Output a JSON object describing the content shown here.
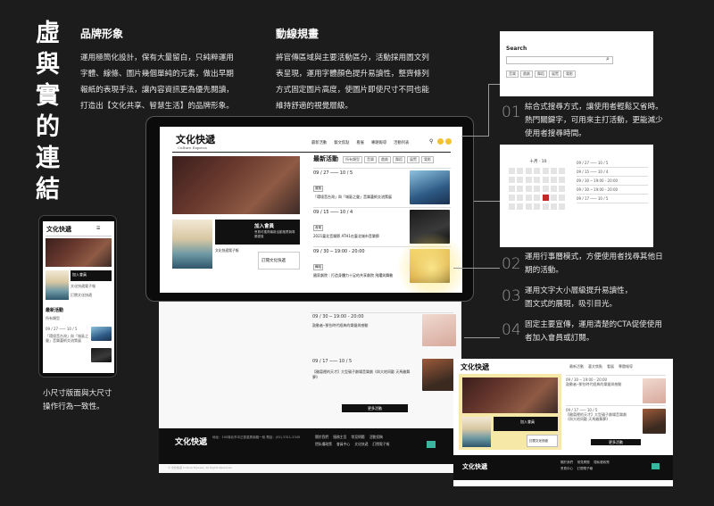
{
  "title_vertical": [
    "虛",
    "與",
    "實",
    "的",
    "連",
    "結"
  ],
  "brand": {
    "heading": "品牌形象",
    "lines": [
      "運用極簡化設計，保有大量留白，只純粹運用",
      "字體、線條、圖片幾個單純的元素，做出早期",
      "報紙的表現手法，讓內容資訊更為優先閱讀，",
      "打造出【文化共享、智慧生活】的品牌形象。"
    ]
  },
  "flow": {
    "heading": "動線規畫",
    "lines": [
      "將官傳區域與主要活動區分，活動採用圖文列",
      "表呈現，運用字體顏色提升易讀性，整齊條列",
      "方式固定圖片高度，使圖片即使尺寸不同也能",
      "維持舒適的視覺層級。"
    ]
  },
  "mobile_caption": [
    "小尺寸版面與大尺寸",
    "操作行為一致性。"
  ],
  "notes": [
    {
      "num": "01",
      "lines": [
        "綜合式搜尋方式，讓使用者輕鬆又省時。",
        "熱門關鍵字，可用來主打活動，更能減少",
        "使用者搜尋時間。"
      ]
    },
    {
      "num": "02",
      "lines": [
        "運用行事曆模式，方便使用者找尋其他日",
        "期的活動。"
      ]
    },
    {
      "num": "03",
      "lines": [
        "運用文字大小層級提升易讀性，",
        "圖文式的展現，吸引目光。"
      ]
    },
    {
      "num": "04",
      "lines": [
        "固定主要宣傳，運用清楚的CTA促使使用",
        "者加入會員或訂閱。"
      ]
    }
  ],
  "site": {
    "logo": "文化快遞",
    "logo_sub": "Culture Express",
    "nav": [
      "最新活動",
      "藝文焦點",
      "看展",
      "專題報導",
      "活動列表"
    ],
    "latest_heading": "最新活動",
    "filters": [
      "所有類型",
      "音樂",
      "戲劇",
      "舞蹈",
      "展覽",
      "電影",
      "其他"
    ],
    "join_title": "加入會員",
    "join_text": "會員可獲得最新活動推薦與專屬優惠",
    "subscribe": "訂閱文化快遞",
    "app_label": "文化快遞電子報",
    "more_button": "更多活動",
    "search_title": "Search",
    "calendar_month": "十月 · 10",
    "events": [
      {
        "date": "09 / 27 ─── 10 / 5",
        "tag": "展覽",
        "text": "「環境音台灣」與「城區之聲」音樂藝術交流策展",
        "thumb": "t-ocean"
      },
      {
        "date": "09 / 15 ─── 10 / 4",
        "tag": "音樂",
        "text": "2021臺北音樂節 ATH1在臺北城市音樂節",
        "thumb": "t-dark"
      },
      {
        "date": "09 / 30 ─ 19:00 - 20:00",
        "tag": "舞蹈",
        "text": "國家劇院｜打造身體力十足的共享劇院 飛躍與舞動",
        "thumb": "t-yellow"
      },
      {
        "date": "09 / 30 ─ 19:00 - 20:00",
        "tag": "音樂",
        "text": "鼓動者─那些時代經典的樂聲與感動",
        "thumb": "t-pink"
      },
      {
        "date": "09 / 17 ─── 10 / 5",
        "tag": "戲劇",
        "text": "【雞窩裡的天才】大型親子劇場音樂劇《與大地同歡 天馬雞舞夢》",
        "thumb": "t-warm"
      }
    ],
    "footer_cols": [
      "關於我們",
      "服務主旨",
      "常見問題",
      "活動投稿",
      "隱私權政策",
      "會員中心",
      "文化快遞",
      "訂閱電子報"
    ],
    "footer_addr": "地址：100臺北市中正區重慶南路一段 電話：(02) 2311-2345",
    "copyright": "© 文化快遞 Culture Express. All Rights Reserved."
  }
}
